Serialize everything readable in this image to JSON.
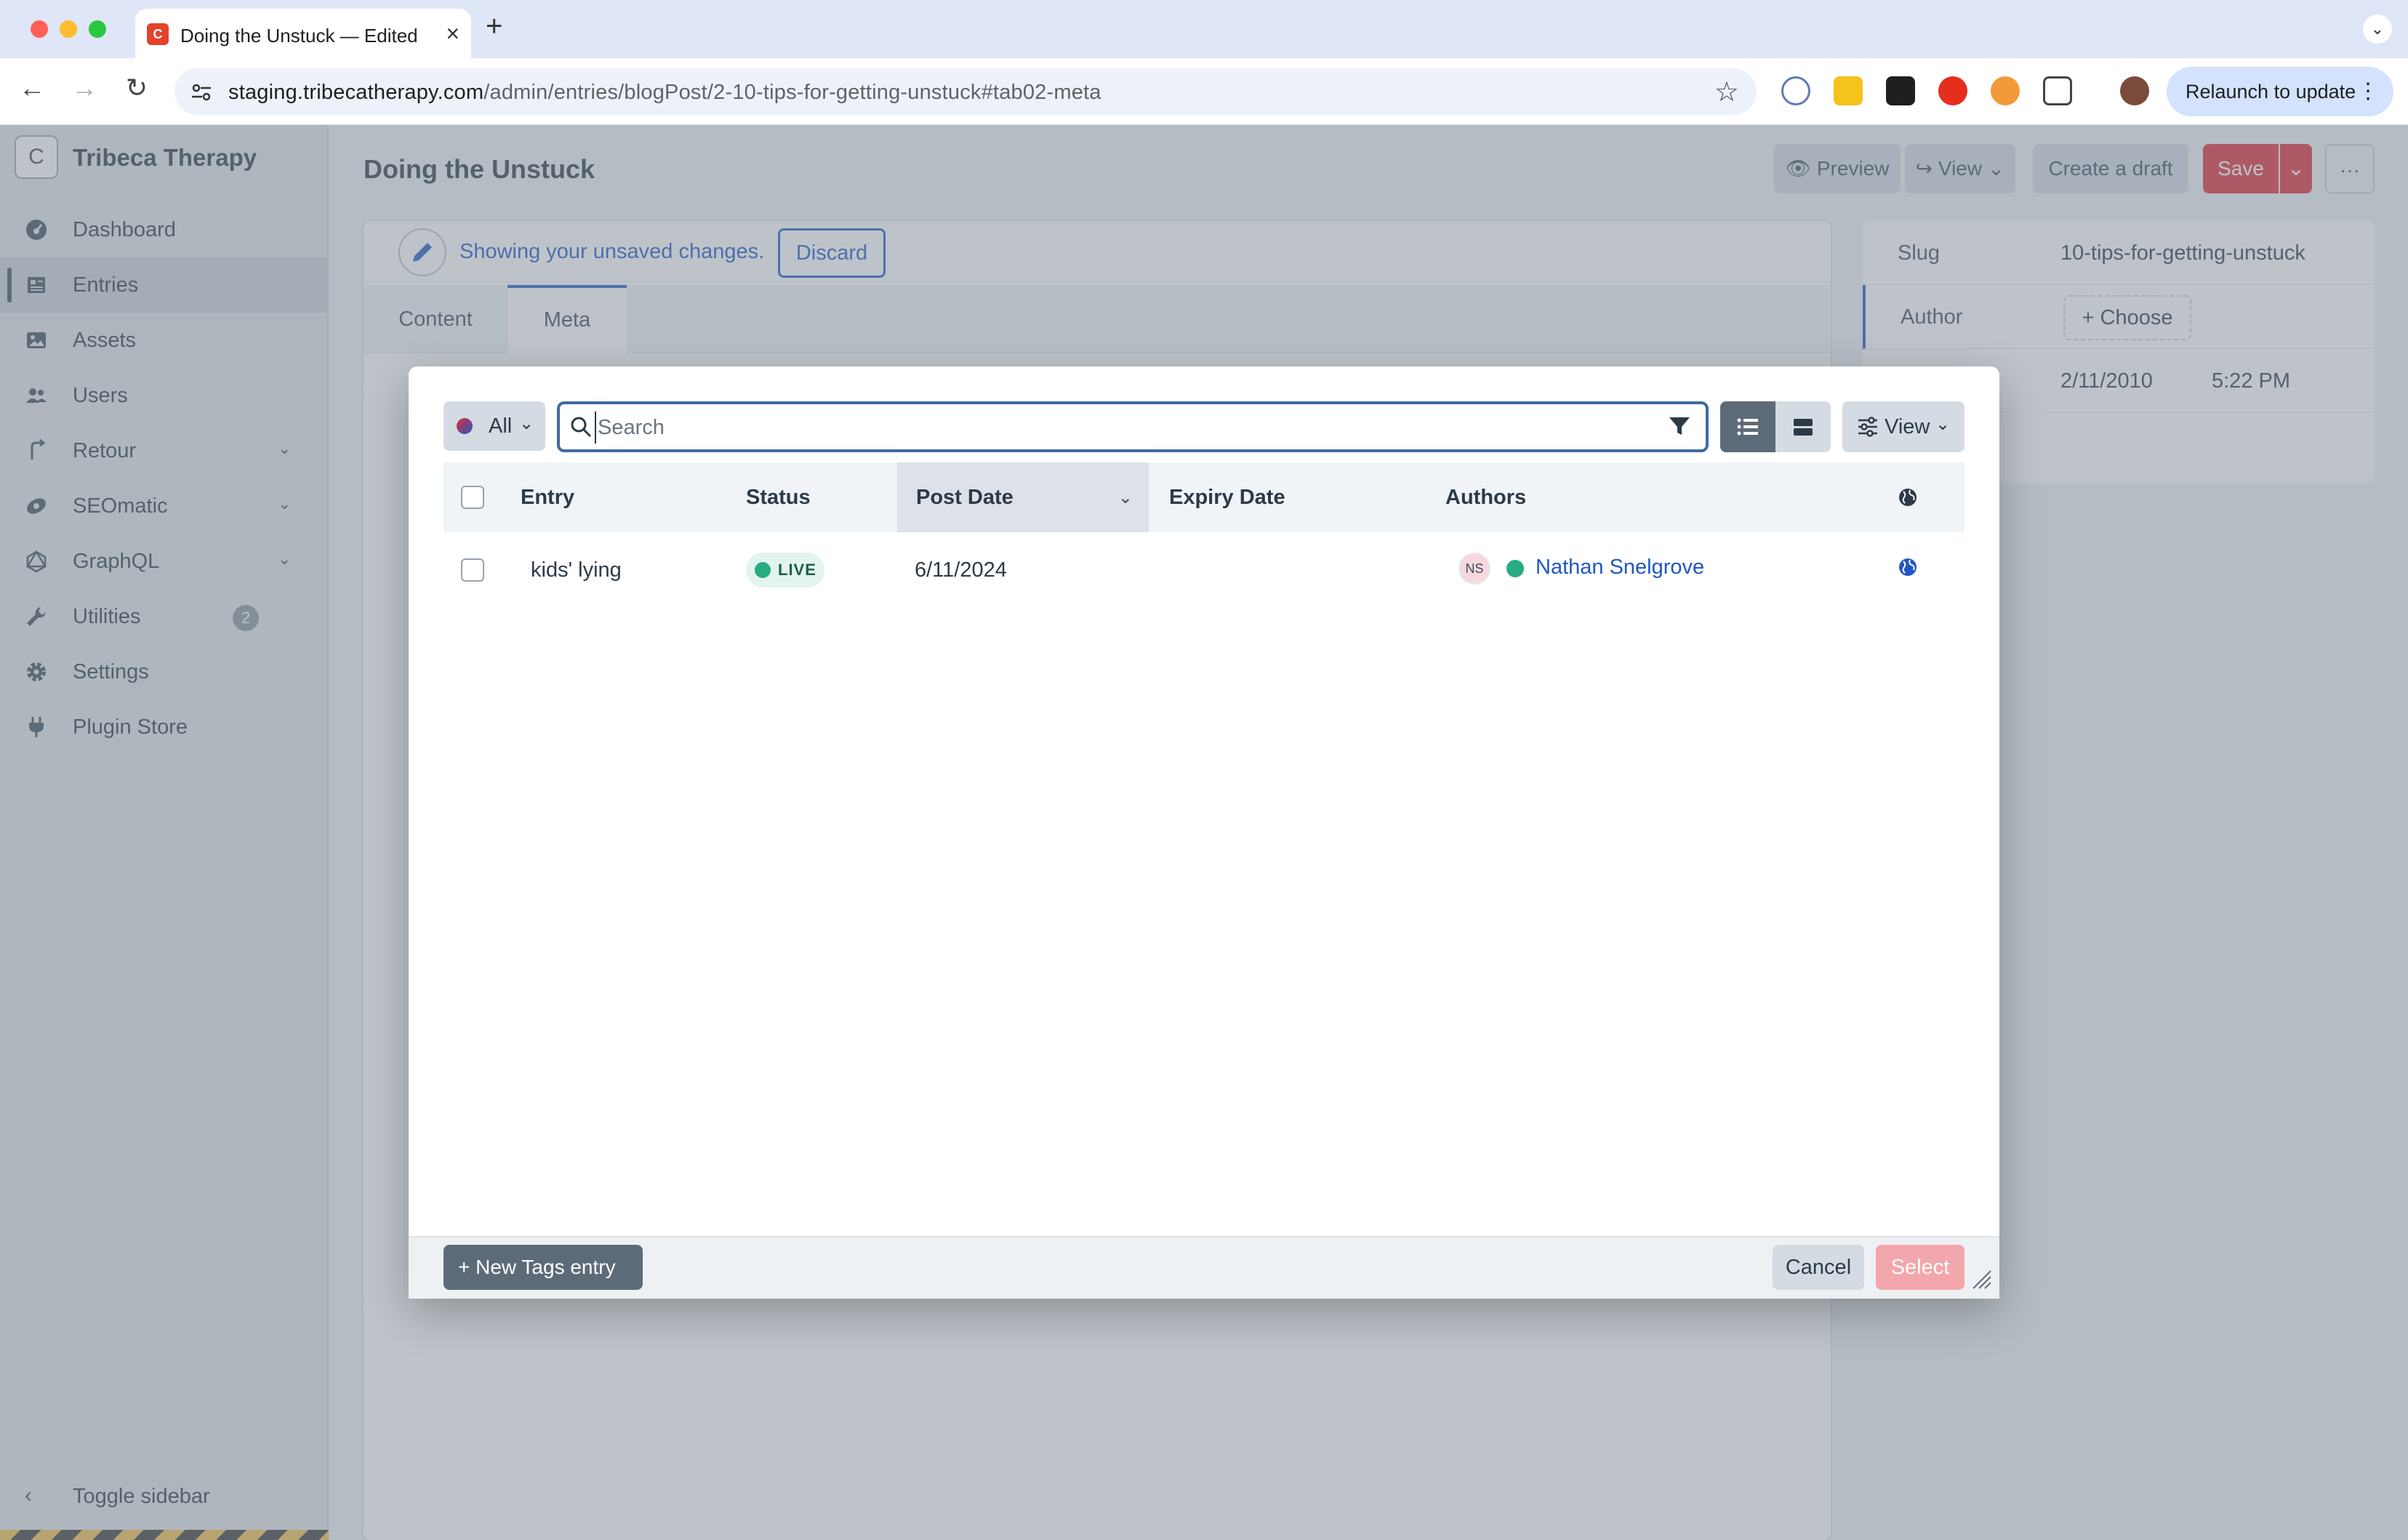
{
  "browser": {
    "tab_title": "Doing the Unstuck — Edited",
    "favicon_letter": "C",
    "url_host": "staging.tribecatherapy.com",
    "url_path": "/admin/entries/blogPost/2-10-tips-for-getting-unstuck#tab02-meta",
    "relaunch_label": "Relaunch to update"
  },
  "sidebar": {
    "brand_letter": "C",
    "site_name": "Tribeca Therapy",
    "items": [
      {
        "label": "Dashboard"
      },
      {
        "label": "Entries"
      },
      {
        "label": "Assets"
      },
      {
        "label": "Users"
      },
      {
        "label": "Retour"
      },
      {
        "label": "SEOmatic"
      },
      {
        "label": "GraphQL"
      },
      {
        "label": "Utilities",
        "badge": "2"
      },
      {
        "label": "Settings"
      },
      {
        "label": "Plugin Store"
      }
    ],
    "toggle_label": "Toggle sidebar"
  },
  "header": {
    "title": "Doing the Unstuck",
    "preview_label": "Preview",
    "view_label": "View",
    "draft_label": "Create a draft",
    "save_label": "Save"
  },
  "editor": {
    "notice": "Showing your unsaved changes.",
    "discard_label": "Discard",
    "tabs": [
      {
        "label": "Content"
      },
      {
        "label": "Meta"
      }
    ]
  },
  "meta": {
    "slug_label": "Slug",
    "slug_value": "10-tips-for-getting-unstuck",
    "author_label": "Author",
    "author_choose": "Choose",
    "post_date": "2/11/2010",
    "post_time": "5:22 PM"
  },
  "modal": {
    "source_label": "All",
    "search_placeholder": "Search",
    "view_label": "View",
    "columns": {
      "entry": "Entry",
      "status": "Status",
      "post_date": "Post Date",
      "expiry_date": "Expiry Date",
      "authors": "Authors"
    },
    "rows": [
      {
        "title": "kids' lying",
        "status": "LIVE",
        "post_date": "6/11/2024",
        "expiry_date": "",
        "author_initials": "NS",
        "author_name": "Nathan Snelgrove"
      }
    ],
    "new_entry_label": "New Tags entry",
    "cancel_label": "Cancel",
    "select_label": "Select"
  },
  "colors": {
    "accent": "#2157c3",
    "save": "#e12d39",
    "live": "#27ab83"
  }
}
